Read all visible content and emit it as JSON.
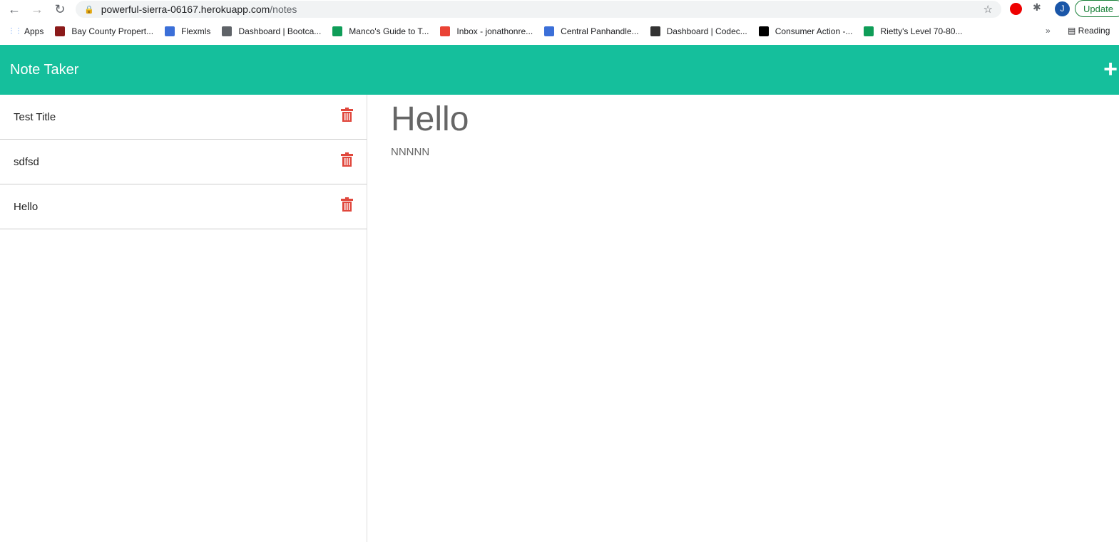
{
  "browser": {
    "url_host": "powerful-sierra-06167.herokuapp.com",
    "url_path": "/notes",
    "update_label": "Update",
    "profile_initial": "J",
    "reading_label": "Reading",
    "overflow_label": "»",
    "bookmarks": [
      {
        "label": "Apps",
        "color": "#4285f4"
      },
      {
        "label": "Bay County Propert...",
        "color": "#8b1a1a"
      },
      {
        "label": "Flexmls",
        "color": "#3b6fd8"
      },
      {
        "label": "Dashboard | Bootca...",
        "color": "#5f6368"
      },
      {
        "label": "Manco's Guide to T...",
        "color": "#0f9d58"
      },
      {
        "label": "Inbox - jonathonre...",
        "color": "#ea4335"
      },
      {
        "label": "Central Panhandle...",
        "color": "#3b6fd8"
      },
      {
        "label": "Dashboard | Codec...",
        "color": "#333333"
      },
      {
        "label": "Consumer Action -...",
        "color": "#000000"
      },
      {
        "label": "Rietty's Level 70-80...",
        "color": "#0f9d58"
      }
    ]
  },
  "app": {
    "title": "Note Taker",
    "accent": "#15bf9c",
    "delete_color": "#e0473c"
  },
  "notes": [
    {
      "title": "Test Title"
    },
    {
      "title": "sdfsd"
    },
    {
      "title": "Hello"
    }
  ],
  "active_note": {
    "title": "Hello",
    "text": "NNNNN"
  }
}
